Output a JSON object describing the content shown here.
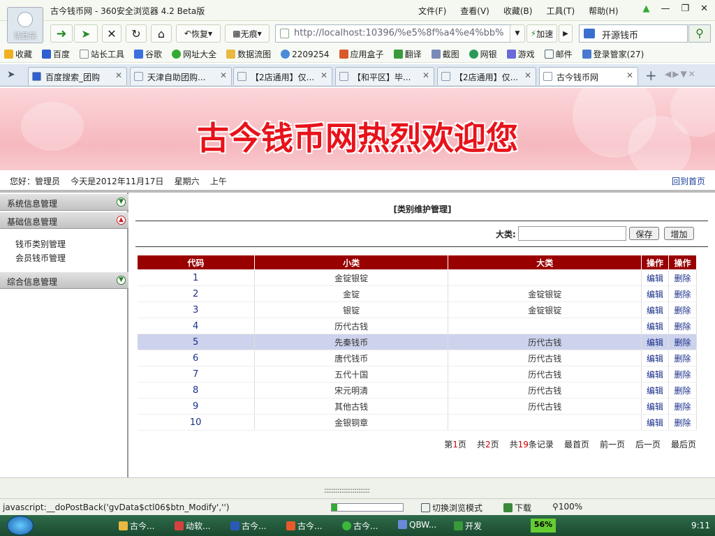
{
  "browser": {
    "title": "古今钱币网 - 360安全浏览器 4.2 Beta版",
    "login_label": "请登录",
    "menus": [
      "文件(F)",
      "查看(V)",
      "收藏(B)",
      "工具(T)",
      "帮助(H)"
    ],
    "restore_label": "恢复",
    "trace_label": "无痕",
    "url": "http://localhost:10396/%e5%8f%a4%e4%bb%",
    "accelerate_label": "加速",
    "search_value": "开源钱币",
    "favorites": [
      "收藏",
      "百度",
      "站长工具",
      "谷歌",
      "网址大全",
      "数据流图",
      "2209254",
      "应用盒子",
      "翻译",
      "截图",
      "网银",
      "游戏",
      "邮件",
      "登录管家(27)"
    ],
    "tabs": [
      "百度搜索_团购",
      "天津自助团购...",
      "【2店通用】仅...",
      "【和平区】毕...",
      "【2店通用】仅...",
      "古今钱币网"
    ]
  },
  "page": {
    "banner_title": "古今钱币网热烈欢迎您",
    "greeting": "您好：管理员    今天是2012年11月17日    星期六    上午",
    "home_link": "回到首页",
    "sidebar": {
      "sections": [
        "系统信息管理",
        "基础信息管理",
        "综合信息管理"
      ],
      "items": [
        "钱币类别管理",
        "会员钱币管理"
      ]
    },
    "main": {
      "title": "[类别维护管理]",
      "big_category_label": "大类:",
      "save_label": "保存",
      "add_label": "增加",
      "headers": [
        "代码",
        "小类",
        "大类",
        "操作",
        "操作"
      ],
      "edit_label": "编辑",
      "delete_label": "删除",
      "rows": [
        {
          "code": "1",
          "small": "金锭银锭",
          "big": ""
        },
        {
          "code": "2",
          "small": "金锭",
          "big": "金锭银锭"
        },
        {
          "code": "3",
          "small": "银锭",
          "big": "金锭银锭"
        },
        {
          "code": "4",
          "small": "历代古钱",
          "big": ""
        },
        {
          "code": "5",
          "small": "先秦钱币",
          "big": "历代古钱"
        },
        {
          "code": "6",
          "small": "唐代钱币",
          "big": "历代古钱"
        },
        {
          "code": "7",
          "small": "五代十国",
          "big": "历代古钱"
        },
        {
          "code": "8",
          "small": "宋元明清",
          "big": "历代古钱"
        },
        {
          "code": "9",
          "small": "其他古钱",
          "big": "历代古钱"
        },
        {
          "code": "10",
          "small": "金银铜章",
          "big": ""
        }
      ],
      "pager": {
        "page_prefix": "第",
        "page_num": "1",
        "page_suffix": "页",
        "total_pages_prefix": "共",
        "total_pages": "2",
        "total_pages_suffix": "页",
        "total_records_prefix": "共",
        "total_records": "19",
        "total_records_suffix": "条记录",
        "first": "最首页",
        "prev": "前一页",
        "next": "后一页",
        "last": "最后页"
      }
    }
  },
  "statusbar": {
    "text": "javascript:__doPostBack('gvData$ctl06$btn_Modify','')",
    "switch_mode": "切换浏览模式",
    "download": "下载",
    "zoom": "100%"
  },
  "taskbar": {
    "items": [
      "古今...",
      "动软...",
      "古今...",
      "古今...",
      "古今...",
      "QBW...",
      "开发"
    ],
    "battery": "56%",
    "clock": "9:11"
  }
}
